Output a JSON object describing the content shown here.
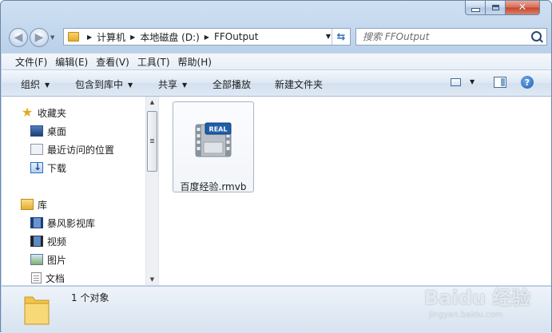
{
  "window": {
    "controls": [
      "minimize",
      "maximize",
      "close"
    ]
  },
  "nav": {
    "address_crumbs": [
      "计算机",
      "本地磁盘 (D:)",
      "FFOutput"
    ],
    "search_placeholder": "搜索 FFOutput"
  },
  "menu": [
    "文件(F)",
    "编辑(E)",
    "查看(V)",
    "工具(T)",
    "帮助(H)"
  ],
  "commands": {
    "organize": "组织",
    "include_in_library": "包含到库中",
    "share": "共享",
    "burn": "全部播放",
    "new_folder": "新建文件夹"
  },
  "sidebar": {
    "favorites": {
      "header": "收藏夹",
      "items": [
        "桌面",
        "最近访问的位置",
        "下载"
      ]
    },
    "libraries": {
      "header": "库",
      "items": [
        "暴风影视库",
        "视频",
        "图片",
        "文档"
      ]
    }
  },
  "files": [
    {
      "name": "百度经验.rmvb",
      "icon": "real-media-icon",
      "selected": true
    }
  ],
  "status": {
    "text": "1 个对象"
  },
  "watermark": {
    "main": "Baidu 经验",
    "sub": "jingyan.baidu.com"
  }
}
